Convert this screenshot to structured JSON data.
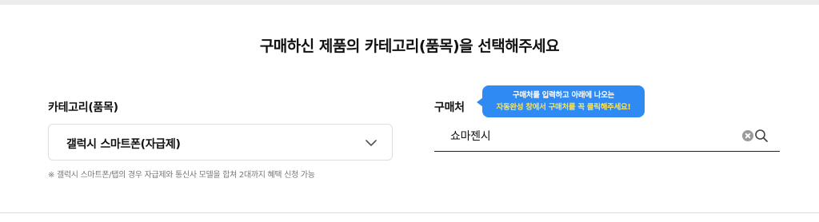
{
  "page": {
    "title": "구매하신 제품의 카테고리(품목)을 선택해주세요"
  },
  "category": {
    "label": "카테고리(품목)",
    "selected": "갤럭시 스마트폰(자급제)",
    "note": "※ 갤럭시 스마트폰/탭의 경우 자급제와 통신사 모델을 합쳐 2대까지 혜택 신청 가능"
  },
  "shop": {
    "label": "구매처",
    "value": "쇼마젠시",
    "tooltip_line1": "구매처를 입력하고 아래에 나오는",
    "tooltip_line2": "자동완성 창에서 구매처를 꼭 클릭해주세요!"
  },
  "icons": {
    "chevron": "chevron-down-icon",
    "clear": "clear-icon",
    "search": "search-icon"
  },
  "colors": {
    "tooltip_bg": "#2f8bf3",
    "tooltip_highlight": "#ffe14d"
  }
}
